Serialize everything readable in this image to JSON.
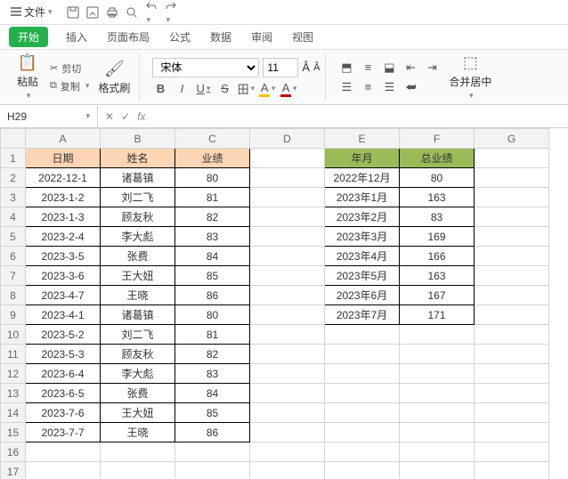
{
  "menu": {
    "file": "文件",
    "tabs": [
      "开始",
      "插入",
      "页面布局",
      "公式",
      "数据",
      "审阅",
      "视图"
    ]
  },
  "clipboard": {
    "paste": "粘贴",
    "cut": "剪切",
    "copy": "复制",
    "format_painter": "格式刷"
  },
  "font": {
    "name": "宋体",
    "size": "11"
  },
  "merge": {
    "label": "合并居中"
  },
  "cellref": "H29",
  "left": {
    "headers": [
      "日期",
      "姓名",
      "业绩"
    ],
    "rows": [
      [
        "2022-12-1",
        "诸葛镇",
        "80"
      ],
      [
        "2023-1-2",
        "刘二飞",
        "81"
      ],
      [
        "2023-1-3",
        "顾友秋",
        "82"
      ],
      [
        "2023-2-4",
        "李大彪",
        "83"
      ],
      [
        "2023-3-5",
        "张费",
        "84"
      ],
      [
        "2023-3-6",
        "王大妞",
        "85"
      ],
      [
        "2023-4-7",
        "王晓",
        "86"
      ],
      [
        "2023-4-1",
        "诸葛镇",
        "80"
      ],
      [
        "2023-5-2",
        "刘二飞",
        "81"
      ],
      [
        "2023-5-3",
        "顾友秋",
        "82"
      ],
      [
        "2023-6-4",
        "李大彪",
        "83"
      ],
      [
        "2023-6-5",
        "张费",
        "84"
      ],
      [
        "2023-7-6",
        "王大妞",
        "85"
      ],
      [
        "2023-7-7",
        "王晓",
        "86"
      ]
    ]
  },
  "right": {
    "headers": [
      "年月",
      "总业绩"
    ],
    "rows": [
      [
        "2022年12月",
        "80"
      ],
      [
        "2023年1月",
        "163"
      ],
      [
        "2023年2月",
        "83"
      ],
      [
        "2023年3月",
        "169"
      ],
      [
        "2023年4月",
        "166"
      ],
      [
        "2023年5月",
        "163"
      ],
      [
        "2023年6月",
        "167"
      ],
      [
        "2023年7月",
        "171"
      ]
    ]
  },
  "cols": [
    "A",
    "B",
    "C",
    "D",
    "E",
    "F",
    "G"
  ],
  "row_count": 17
}
